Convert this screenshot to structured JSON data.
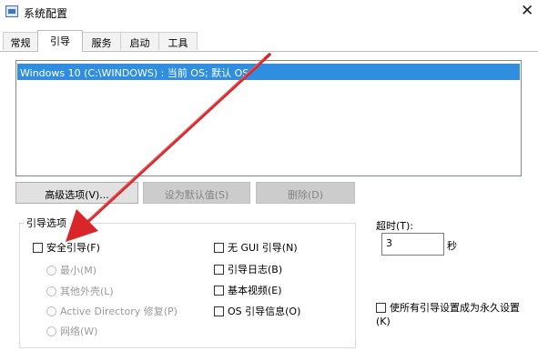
{
  "window": {
    "title": "系统配置",
    "close_glyph": "✕"
  },
  "tabs": [
    {
      "label": "常规",
      "active": false
    },
    {
      "label": "引导",
      "active": true
    },
    {
      "label": "服务",
      "active": false
    },
    {
      "label": "启动",
      "active": false
    },
    {
      "label": "工具",
      "active": false
    }
  ],
  "boot_list": {
    "items": [
      "Windows 10 (C:\\WINDOWS) : 当前 OS; 默认 OS"
    ],
    "selected_index": 0
  },
  "buttons": {
    "advanced": "高级选项(V)...",
    "set_default": "设为默认值(S)",
    "delete": "删除(D)"
  },
  "boot_options": {
    "group_label": "引导选项",
    "safe_boot": {
      "label": "安全引导(F)",
      "checked": false
    },
    "minimal": "最小(M)",
    "alternate_shell": "其他外壳(L)",
    "active_directory": "Active Directory 修复(P)",
    "network": "网络(W)",
    "no_gui": {
      "label": "无 GUI 引导(N)",
      "checked": false
    },
    "boot_log": {
      "label": "引导日志(B)",
      "checked": false
    },
    "base_video": {
      "label": "基本视频(E)",
      "checked": false
    },
    "os_boot_info": {
      "label": "OS 引导信息(O)",
      "checked": false
    }
  },
  "timeout": {
    "label": "超时(T):",
    "value": "3",
    "unit": "秒"
  },
  "make_permanent": {
    "label": "使所有引导设置成为永久设置(K)",
    "checked": false
  },
  "colors": {
    "selection": "#2f8ee0",
    "annotation_arrow": "#d9262a"
  },
  "icons": {
    "app": "system-config-icon",
    "close": "close-icon"
  }
}
